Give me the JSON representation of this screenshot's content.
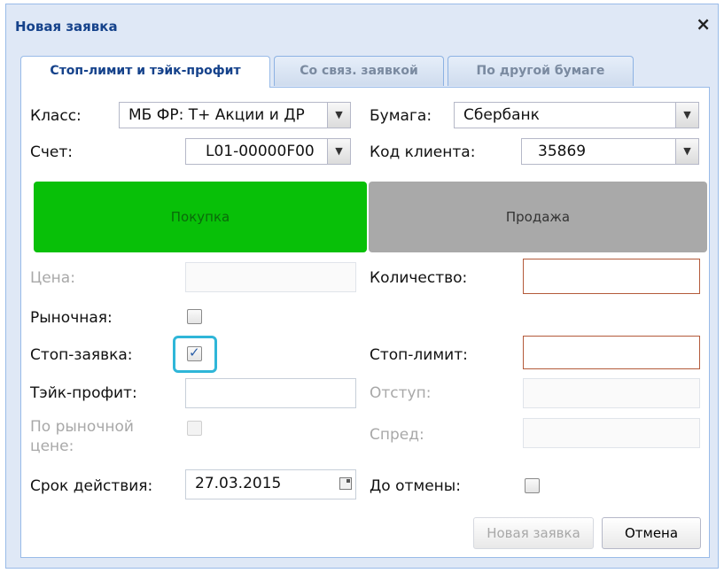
{
  "window": {
    "title": "Новая заявка",
    "close": "×"
  },
  "tabs": [
    {
      "label": "Стоп-лимит и тэйк-профит",
      "active": true
    },
    {
      "label": "Со связ. заявкой",
      "active": false
    },
    {
      "label": "По другой бумаге",
      "active": false
    }
  ],
  "form": {
    "class_label": "Класс:",
    "class_value": "МБ ФР: Т+ Акции и ДР",
    "security_label": "Бумага:",
    "security_value": "Сбербанк",
    "account_label": "Счет:",
    "account_value": "L01-00000F00",
    "client_label": "Код клиента:",
    "client_value": "35869",
    "buy": "Покупка",
    "sell": "Продажа",
    "price_label": "Цена:",
    "quantity_label": "Количество:",
    "market_label": "Рыночная:",
    "market_checked": false,
    "stop_order_label": "Стоп-заявка:",
    "stop_order_checked": true,
    "stop_limit_label": "Стоп-лимит:",
    "take_profit_label": "Тэйк-профит:",
    "offset_label": "Отступ:",
    "market_price_label_1": "По рыночной",
    "market_price_label_2": "цене:",
    "spread_label": "Спред:",
    "validity_label": "Срок действия:",
    "validity_value": "27.03.2015",
    "until_cancel_label": "До отмены:",
    "until_cancel_checked": false
  },
  "buttons": {
    "submit": "Новая заявка",
    "cancel": "Отмена"
  },
  "colors": {
    "buy": "#08c008",
    "sell": "#a9a9a9",
    "highlight": "#2fb6d8",
    "title": "#15428b"
  },
  "icons": {
    "close": "close-icon",
    "dropdown": "chevron-down-icon",
    "calendar": "calendar-icon",
    "check": "checkmark-icon"
  }
}
